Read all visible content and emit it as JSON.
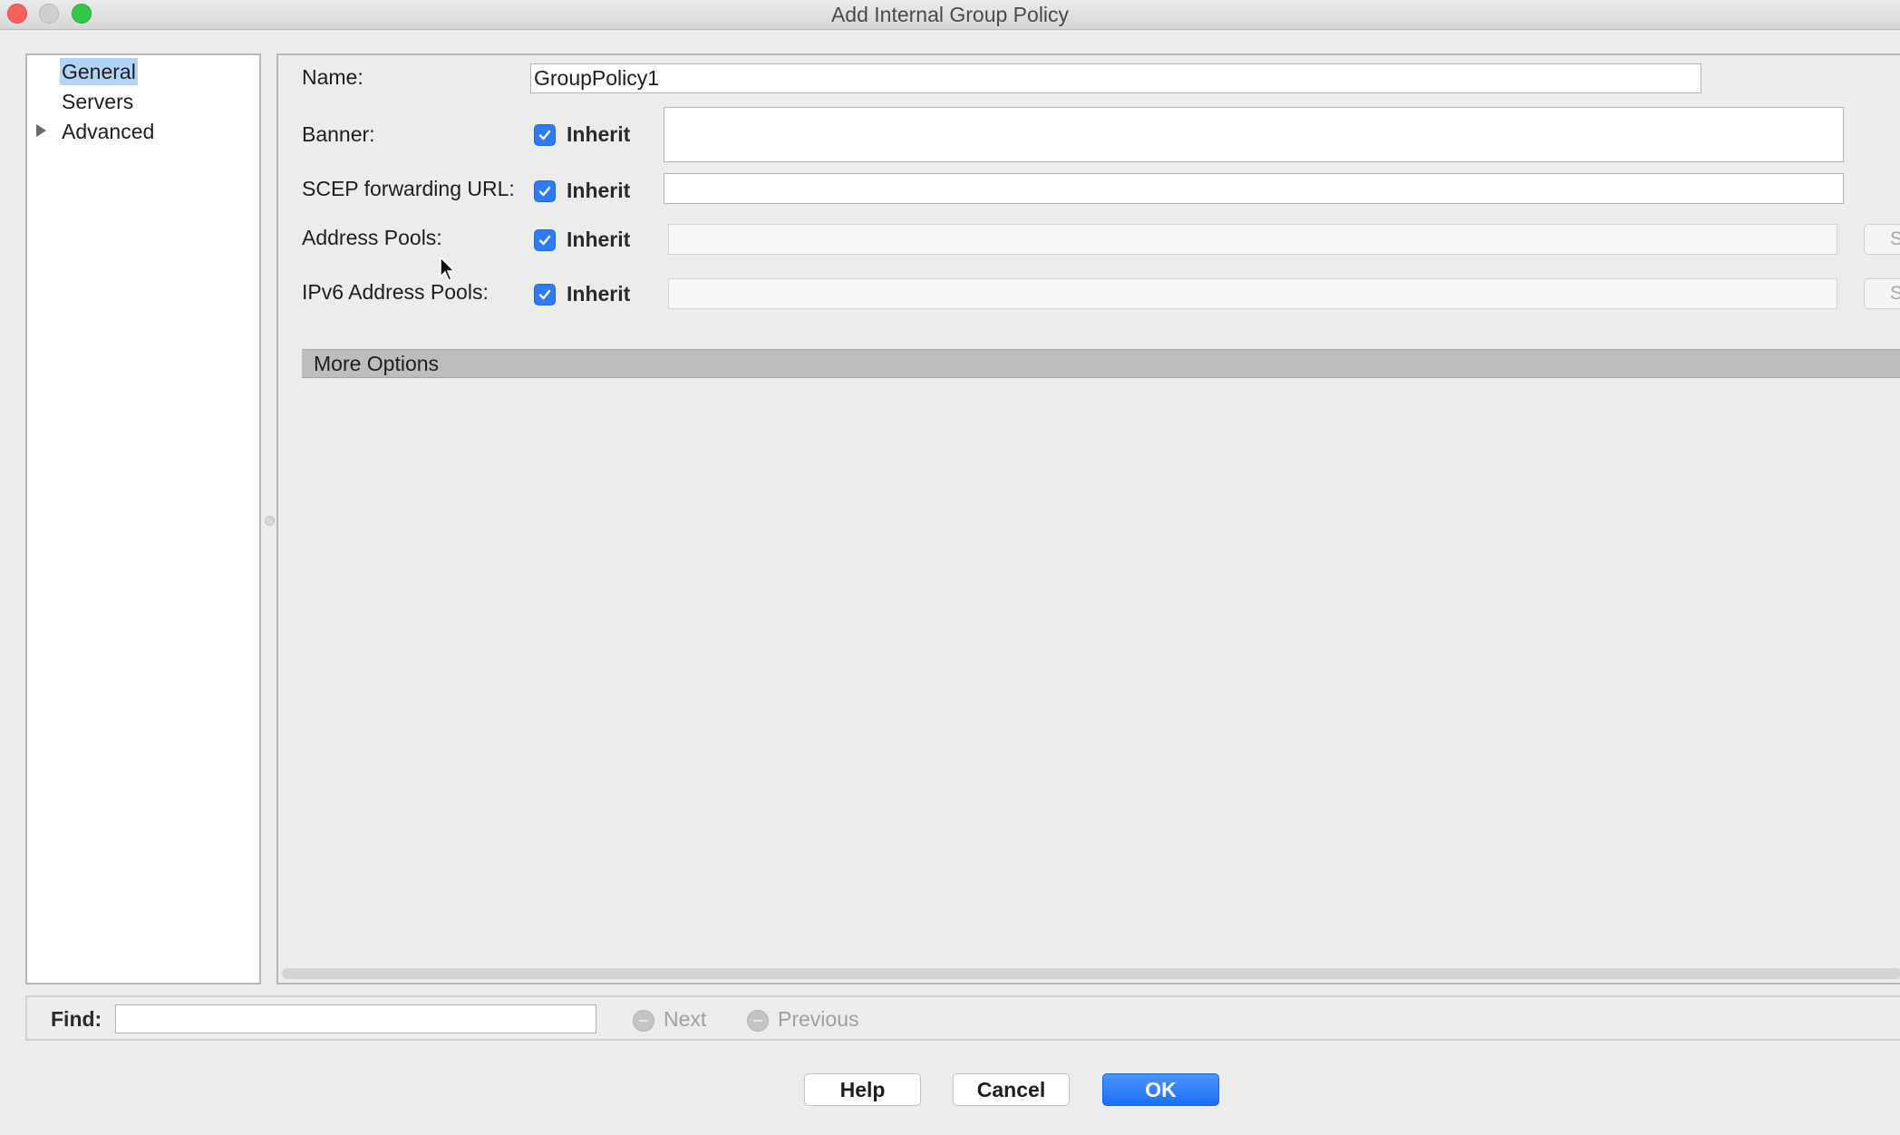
{
  "window": {
    "title": "Add Internal Group Policy"
  },
  "tree": {
    "items": [
      {
        "label": "General",
        "selected": true
      },
      {
        "label": "Servers"
      },
      {
        "label": "Advanced",
        "expandable": true
      }
    ]
  },
  "form": {
    "name": {
      "label": "Name:",
      "value": "GroupPolicy1"
    },
    "banner": {
      "label": "Banner:",
      "inherit_label": "Inherit",
      "inherit_checked": true,
      "value": ""
    },
    "scep": {
      "label": "SCEP forwarding URL:",
      "inherit_label": "Inherit",
      "inherit_checked": true,
      "value": ""
    },
    "address_pools": {
      "label": "Address Pools:",
      "inherit_label": "Inherit",
      "inherit_checked": true,
      "value": "",
      "select_button": "S"
    },
    "ipv6_address_pools": {
      "label": "IPv6 Address Pools:",
      "inherit_label": "Inherit",
      "inherit_checked": true,
      "value": "",
      "select_button": "S"
    }
  },
  "more_options": {
    "label": "More Options"
  },
  "findbar": {
    "label": "Find:",
    "value": "",
    "next_label": "Next",
    "previous_label": "Previous"
  },
  "buttons": {
    "help": "Help",
    "cancel": "Cancel",
    "ok": "OK"
  },
  "colors": {
    "accent": "#2d7cf6",
    "selection": "#b3d2f7",
    "close": "#fc605c",
    "maximize": "#34c84a"
  },
  "icons": {
    "checkbox": "checkmark-icon",
    "tree_expand": "triangle-right-icon",
    "nav": "circle-icon",
    "cursor": "arrow-pointer-icon"
  }
}
